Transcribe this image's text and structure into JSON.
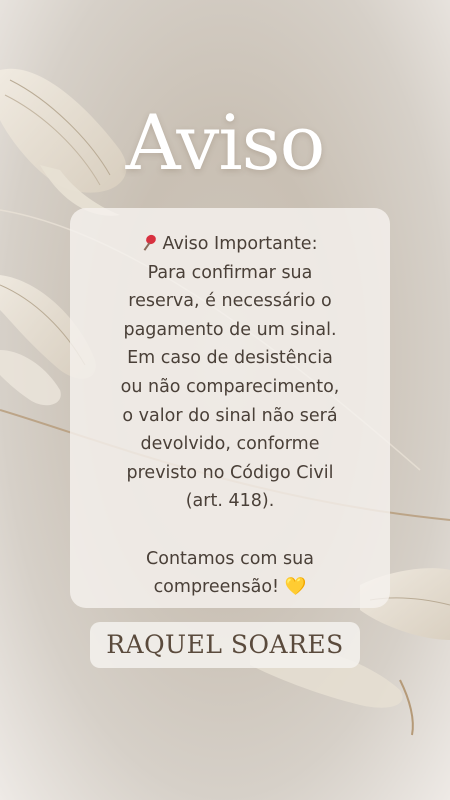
{
  "title": "Aviso",
  "notice": {
    "icon": "pushpin-icon",
    "lines": [
      "Aviso Importante:",
      "Para confirmar sua",
      "reserva, é necessário o",
      "pagamento de um sinal.",
      "Em caso de desistência",
      "ou não comparecimento,",
      "o valor do sinal não será",
      "devolvido, conforme",
      "previsto no Código Civil",
      "(art. 418)."
    ],
    "closing_lines": [
      "Contamos com sua",
      "compreensão!"
    ],
    "closing_emoji": "💛",
    "closing_emoji_icon": "yellow-heart-icon"
  },
  "signature": "RAQUEL SOARES",
  "colors": {
    "title": "#ffffff",
    "card_text": "#4a4038",
    "pin": "#d8303f",
    "heart": "#f2c94c"
  }
}
